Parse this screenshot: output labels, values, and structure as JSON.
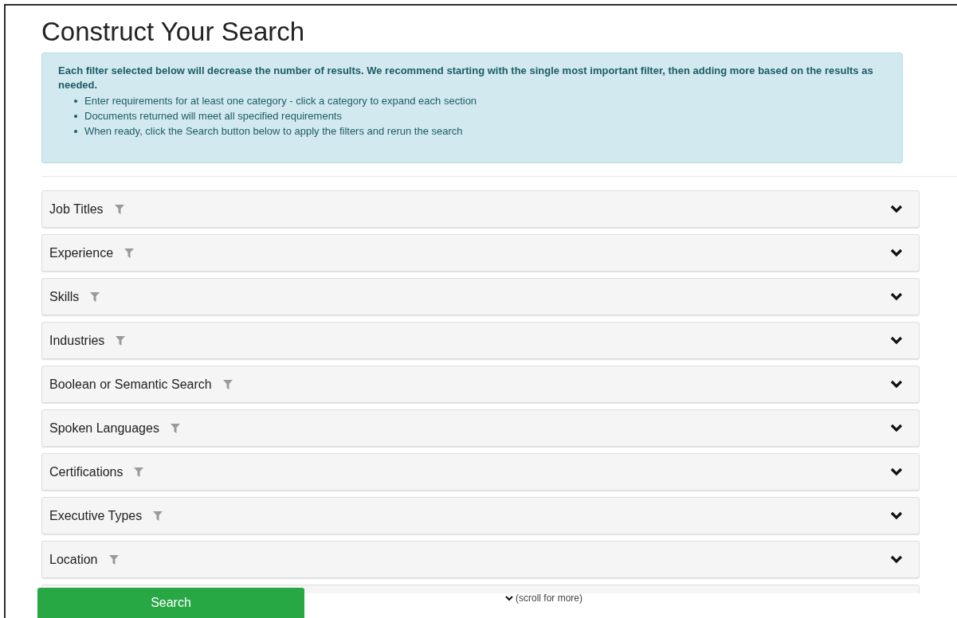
{
  "title": "Construct Your Search",
  "info": {
    "lead": "Each filter selected below will decrease the number of results. We recommend starting with the single most important filter, then adding more based on the results as needed.",
    "bullets": [
      "Enter requirements for at least one category - click a category to expand each section",
      "Documents returned will meet all specified requirements",
      "When ready, click the Search button below to apply the filters and rerun the search"
    ]
  },
  "categories": [
    {
      "label": "Job Titles",
      "expanded": false
    },
    {
      "label": "Experience",
      "expanded": false
    },
    {
      "label": "Skills",
      "expanded": false
    },
    {
      "label": "Industries",
      "expanded": false
    },
    {
      "label": "Boolean or Semantic Search",
      "expanded": false
    },
    {
      "label": "Spoken Languages",
      "expanded": false
    },
    {
      "label": "Certifications",
      "expanded": false
    },
    {
      "label": "Executive Types",
      "expanded": false
    },
    {
      "label": "Location",
      "expanded": false
    }
  ],
  "footer": {
    "button": "Search",
    "scroll_hint": "(scroll for more)"
  }
}
